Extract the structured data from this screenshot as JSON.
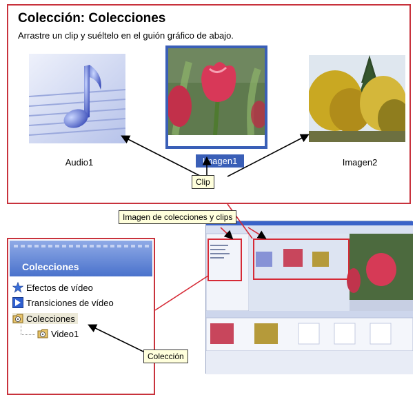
{
  "collection_panel": {
    "title": "Colección: Colecciones",
    "hint": "Arrastre un clip y suéltelo en el guión gráfico de abajo.",
    "clips": [
      {
        "label": "Audio1",
        "icon": "music-note-icon"
      },
      {
        "label": "Imagen1",
        "icon": "tulip-image",
        "selected": true
      },
      {
        "label": "Imagen2",
        "icon": "autumn-trees-image"
      }
    ]
  },
  "callouts": {
    "clip": "Clip",
    "images_and_clips": "Imagen de colecciones y clips",
    "collection": "Colección"
  },
  "tree_panel": {
    "header": "Colecciones",
    "items": [
      {
        "label": "Efectos de vídeo",
        "icon": "star-icon"
      },
      {
        "label": "Transiciones de vídeo",
        "icon": "transition-icon"
      },
      {
        "label": "Colecciones",
        "icon": "film-folder-icon"
      },
      {
        "label": "Video1",
        "icon": "film-folder-icon"
      }
    ]
  },
  "colors": {
    "accent": "#3a5fb7",
    "highlight_border": "#c8323c",
    "callout_bg": "#ffffdc"
  }
}
